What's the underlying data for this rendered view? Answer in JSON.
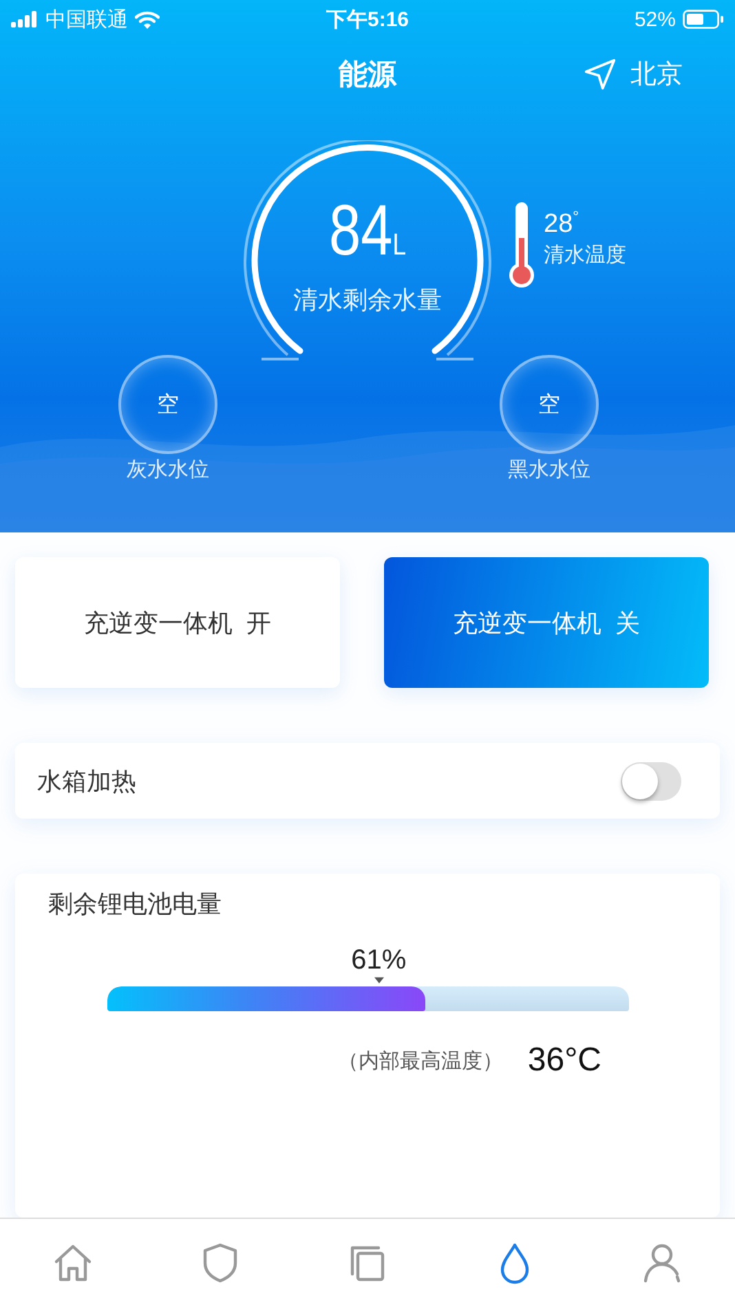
{
  "status_bar": {
    "carrier": "中国联通",
    "time": "下午5:16",
    "battery": "52%"
  },
  "header": {
    "title": "能源",
    "location": "北京"
  },
  "gauge": {
    "value": "84",
    "unit": "L",
    "label": "清水剩余水量"
  },
  "water_temperature": {
    "value": "28",
    "unit": "°",
    "label": "清水温度"
  },
  "tanks": [
    {
      "value": "空",
      "label": "灰水水位"
    },
    {
      "value": "空",
      "label": "黑水水位"
    }
  ],
  "mode_buttons": [
    {
      "label": "充逆变一体机  开",
      "selected": false
    },
    {
      "label": "充逆变一体机  关",
      "selected": true
    }
  ],
  "heater": {
    "label": "水箱加热",
    "on": false
  },
  "battery": {
    "title": "剩余锂电池电量",
    "percent": "61%",
    "level": 0.61,
    "temp_label": "（内部最高温度）",
    "temp_value": "36°C"
  },
  "tab_bar": [
    {
      "kind": "home",
      "selected": false
    },
    {
      "kind": "shield",
      "selected": false
    },
    {
      "kind": "copy",
      "selected": false
    },
    {
      "kind": "drop",
      "selected": true
    },
    {
      "kind": "person",
      "selected": false
    }
  ]
}
